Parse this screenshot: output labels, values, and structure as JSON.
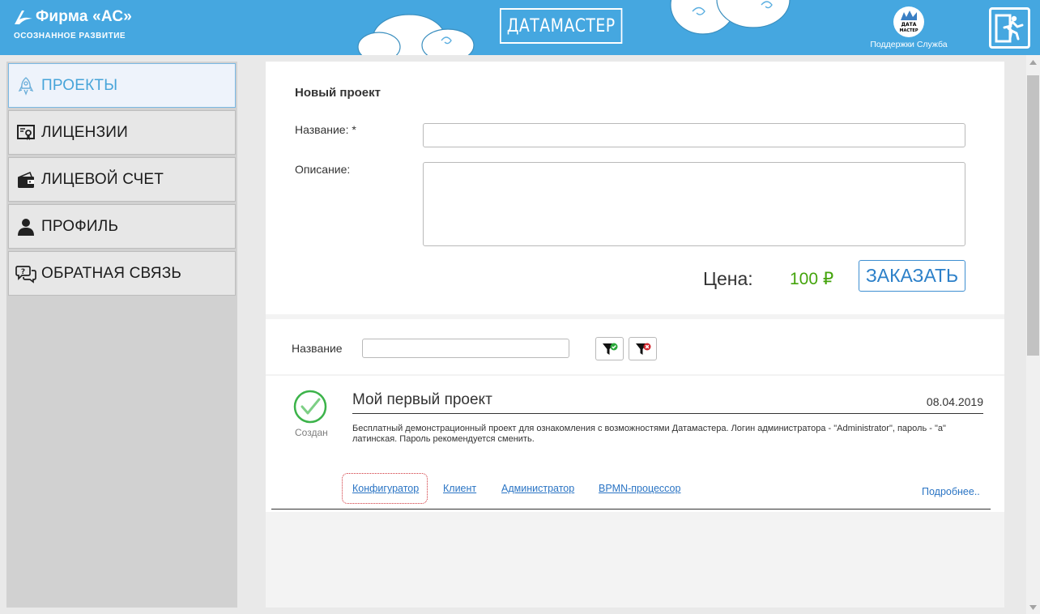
{
  "header": {
    "company_name": "Фирма «АС»",
    "company_tagline": "ОСОЗНАННОЕ РАЗВИТИЕ",
    "brand": "ДАТАМАСТЕР",
    "support_logo_text": "ДАТА МАСТЕР",
    "support_label": "Поддержки Служба",
    "exit_icon": "exit-door-icon"
  },
  "sidebar": {
    "items": [
      {
        "label": "ПРОЕКТЫ",
        "icon": "rocket-icon",
        "active": true
      },
      {
        "label": "ЛИЦЕНЗИИ",
        "icon": "certificate-icon",
        "active": false
      },
      {
        "label": "ЛИЦЕВОЙ СЧЕТ",
        "icon": "wallet-icon",
        "active": false
      },
      {
        "label": "ПРОФИЛЬ",
        "icon": "user-icon",
        "active": false
      },
      {
        "label": "ОБРАТНАЯ СВЯЗЬ",
        "icon": "feedback-icon",
        "active": false
      }
    ]
  },
  "new_project": {
    "title": "Новый проект",
    "name_label": "Название: *",
    "name_value": "",
    "description_label": "Описание:",
    "description_value": "",
    "price_label": "Цена:",
    "price_value": "100 ₽",
    "order_button": "ЗАКАЗАТЬ"
  },
  "filter": {
    "label": "Название",
    "value": "",
    "apply_icon": "filter-apply-icon",
    "clear_icon": "filter-clear-icon"
  },
  "project": {
    "status": "Создан",
    "title": "Мой первый проект",
    "date": "08.04.2019",
    "description": "Бесплатный демонстрационный проект для ознакомления с возможностями Датамастера. Логин администратора - \"Administrator\", пароль - \"а\" латинская. Пароль рекомендуется сменить.",
    "links": [
      "Конфигуратор",
      "Клиент",
      "Администратор",
      "BPMN-процессор"
    ],
    "more": "Подробнее.."
  },
  "colors": {
    "header_bg": "#45a7e0",
    "accent_blue": "#47a4d9",
    "price_green": "#44a40c",
    "link_blue": "#2a74c4"
  }
}
